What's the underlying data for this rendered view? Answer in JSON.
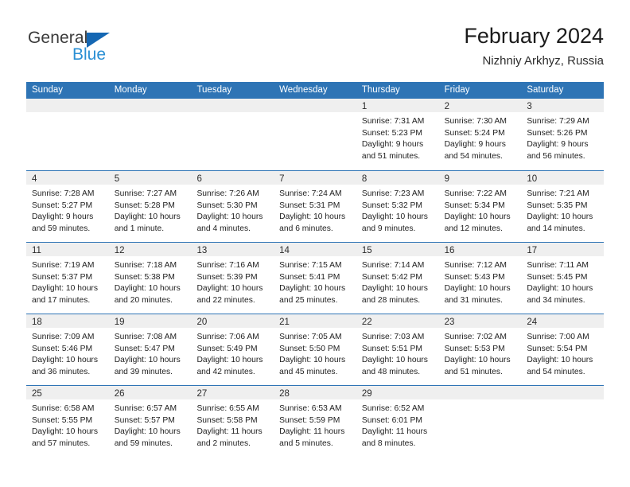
{
  "brand": {
    "name_part1": "General",
    "name_part2": "Blue"
  },
  "header": {
    "title": "February 2024",
    "subtitle": "Nizhniy Arkhyz, Russia"
  },
  "colors": {
    "header_blue": "#2e74b5",
    "logo_blue": "#2a8fd4",
    "triangle_blue": "#1567b3",
    "daynum_band": "#efefef"
  },
  "weekdays": [
    "Sunday",
    "Monday",
    "Tuesday",
    "Wednesday",
    "Thursday",
    "Friday",
    "Saturday"
  ],
  "weeks": [
    [
      {
        "day": "",
        "lines": []
      },
      {
        "day": "",
        "lines": []
      },
      {
        "day": "",
        "lines": []
      },
      {
        "day": "",
        "lines": []
      },
      {
        "day": "1",
        "lines": [
          "Sunrise: 7:31 AM",
          "Sunset: 5:23 PM",
          "Daylight: 9 hours",
          "and 51 minutes."
        ]
      },
      {
        "day": "2",
        "lines": [
          "Sunrise: 7:30 AM",
          "Sunset: 5:24 PM",
          "Daylight: 9 hours",
          "and 54 minutes."
        ]
      },
      {
        "day": "3",
        "lines": [
          "Sunrise: 7:29 AM",
          "Sunset: 5:26 PM",
          "Daylight: 9 hours",
          "and 56 minutes."
        ]
      }
    ],
    [
      {
        "day": "4",
        "lines": [
          "Sunrise: 7:28 AM",
          "Sunset: 5:27 PM",
          "Daylight: 9 hours",
          "and 59 minutes."
        ]
      },
      {
        "day": "5",
        "lines": [
          "Sunrise: 7:27 AM",
          "Sunset: 5:28 PM",
          "Daylight: 10 hours",
          "and 1 minute."
        ]
      },
      {
        "day": "6",
        "lines": [
          "Sunrise: 7:26 AM",
          "Sunset: 5:30 PM",
          "Daylight: 10 hours",
          "and 4 minutes."
        ]
      },
      {
        "day": "7",
        "lines": [
          "Sunrise: 7:24 AM",
          "Sunset: 5:31 PM",
          "Daylight: 10 hours",
          "and 6 minutes."
        ]
      },
      {
        "day": "8",
        "lines": [
          "Sunrise: 7:23 AM",
          "Sunset: 5:32 PM",
          "Daylight: 10 hours",
          "and 9 minutes."
        ]
      },
      {
        "day": "9",
        "lines": [
          "Sunrise: 7:22 AM",
          "Sunset: 5:34 PM",
          "Daylight: 10 hours",
          "and 12 minutes."
        ]
      },
      {
        "day": "10",
        "lines": [
          "Sunrise: 7:21 AM",
          "Sunset: 5:35 PM",
          "Daylight: 10 hours",
          "and 14 minutes."
        ]
      }
    ],
    [
      {
        "day": "11",
        "lines": [
          "Sunrise: 7:19 AM",
          "Sunset: 5:37 PM",
          "Daylight: 10 hours",
          "and 17 minutes."
        ]
      },
      {
        "day": "12",
        "lines": [
          "Sunrise: 7:18 AM",
          "Sunset: 5:38 PM",
          "Daylight: 10 hours",
          "and 20 minutes."
        ]
      },
      {
        "day": "13",
        "lines": [
          "Sunrise: 7:16 AM",
          "Sunset: 5:39 PM",
          "Daylight: 10 hours",
          "and 22 minutes."
        ]
      },
      {
        "day": "14",
        "lines": [
          "Sunrise: 7:15 AM",
          "Sunset: 5:41 PM",
          "Daylight: 10 hours",
          "and 25 minutes."
        ]
      },
      {
        "day": "15",
        "lines": [
          "Sunrise: 7:14 AM",
          "Sunset: 5:42 PM",
          "Daylight: 10 hours",
          "and 28 minutes."
        ]
      },
      {
        "day": "16",
        "lines": [
          "Sunrise: 7:12 AM",
          "Sunset: 5:43 PM",
          "Daylight: 10 hours",
          "and 31 minutes."
        ]
      },
      {
        "day": "17",
        "lines": [
          "Sunrise: 7:11 AM",
          "Sunset: 5:45 PM",
          "Daylight: 10 hours",
          "and 34 minutes."
        ]
      }
    ],
    [
      {
        "day": "18",
        "lines": [
          "Sunrise: 7:09 AM",
          "Sunset: 5:46 PM",
          "Daylight: 10 hours",
          "and 36 minutes."
        ]
      },
      {
        "day": "19",
        "lines": [
          "Sunrise: 7:08 AM",
          "Sunset: 5:47 PM",
          "Daylight: 10 hours",
          "and 39 minutes."
        ]
      },
      {
        "day": "20",
        "lines": [
          "Sunrise: 7:06 AM",
          "Sunset: 5:49 PM",
          "Daylight: 10 hours",
          "and 42 minutes."
        ]
      },
      {
        "day": "21",
        "lines": [
          "Sunrise: 7:05 AM",
          "Sunset: 5:50 PM",
          "Daylight: 10 hours",
          "and 45 minutes."
        ]
      },
      {
        "day": "22",
        "lines": [
          "Sunrise: 7:03 AM",
          "Sunset: 5:51 PM",
          "Daylight: 10 hours",
          "and 48 minutes."
        ]
      },
      {
        "day": "23",
        "lines": [
          "Sunrise: 7:02 AM",
          "Sunset: 5:53 PM",
          "Daylight: 10 hours",
          "and 51 minutes."
        ]
      },
      {
        "day": "24",
        "lines": [
          "Sunrise: 7:00 AM",
          "Sunset: 5:54 PM",
          "Daylight: 10 hours",
          "and 54 minutes."
        ]
      }
    ],
    [
      {
        "day": "25",
        "lines": [
          "Sunrise: 6:58 AM",
          "Sunset: 5:55 PM",
          "Daylight: 10 hours",
          "and 57 minutes."
        ]
      },
      {
        "day": "26",
        "lines": [
          "Sunrise: 6:57 AM",
          "Sunset: 5:57 PM",
          "Daylight: 10 hours",
          "and 59 minutes."
        ]
      },
      {
        "day": "27",
        "lines": [
          "Sunrise: 6:55 AM",
          "Sunset: 5:58 PM",
          "Daylight: 11 hours",
          "and 2 minutes."
        ]
      },
      {
        "day": "28",
        "lines": [
          "Sunrise: 6:53 AM",
          "Sunset: 5:59 PM",
          "Daylight: 11 hours",
          "and 5 minutes."
        ]
      },
      {
        "day": "29",
        "lines": [
          "Sunrise: 6:52 AM",
          "Sunset: 6:01 PM",
          "Daylight: 11 hours",
          "and 8 minutes."
        ]
      },
      {
        "day": "",
        "lines": []
      },
      {
        "day": "",
        "lines": []
      }
    ]
  ]
}
